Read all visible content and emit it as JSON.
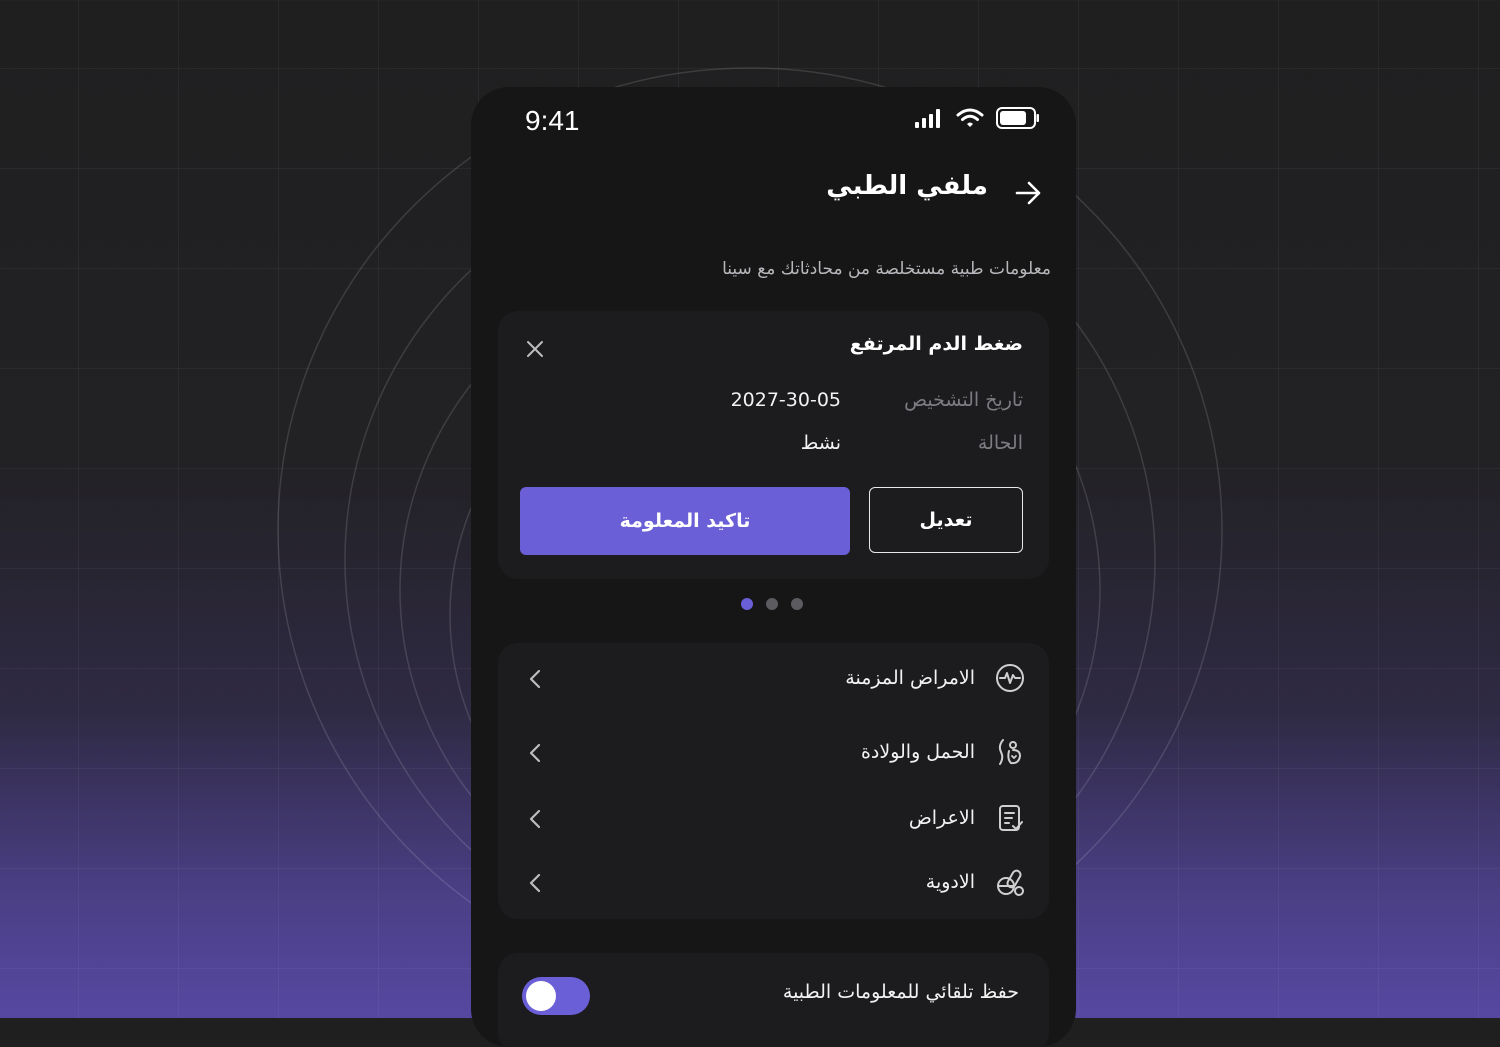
{
  "status_bar": {
    "time": "9:41"
  },
  "header": {
    "title": "ملفي الطبي",
    "subtitle": "معلومات طبية مستخلصة من محادثاتك مع سينا"
  },
  "card": {
    "title": "ضغط الدم المرتفع",
    "diagnosis_label": "تاريخ التشخيص",
    "diagnosis_value": "2027-30-05",
    "status_label": "الحالة",
    "status_value": "نشط",
    "confirm_label": "تاكيد المعلومة",
    "edit_label": "تعديل"
  },
  "pagination": {
    "count": 3,
    "active": 0
  },
  "menu": {
    "items": [
      {
        "label": "الامراض المزمنة",
        "icon": "heart-pulse-icon"
      },
      {
        "label": "الحمل والولادة",
        "icon": "pregnancy-icon"
      },
      {
        "label": "الاعراض",
        "icon": "clipboard-check-icon"
      },
      {
        "label": "الادوية",
        "icon": "pills-icon"
      }
    ]
  },
  "autosave": {
    "label": "حفظ تلقائي للمعلومات الطبية",
    "enabled": true
  },
  "colors": {
    "accent": "#6a5fd6",
    "background": "#161617",
    "card": "#1c1c1e"
  }
}
